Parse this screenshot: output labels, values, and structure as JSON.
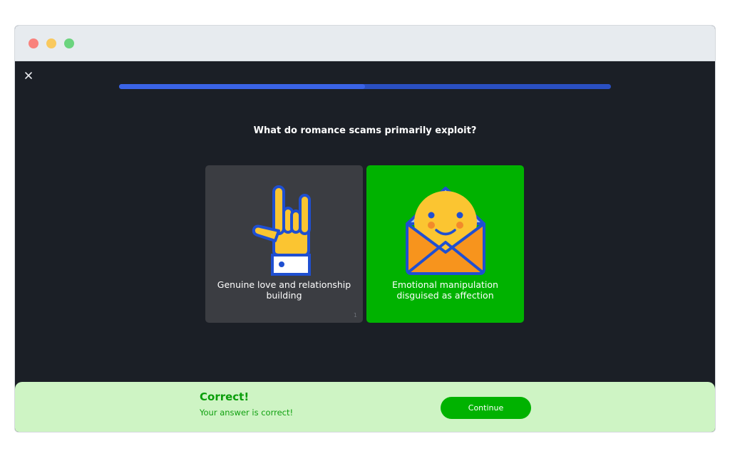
{
  "window": {
    "controls": [
      "close-dot",
      "minimize-dot",
      "zoom-dot"
    ]
  },
  "toolbar": {
    "close_icon": "×"
  },
  "progress": {
    "fraction": 0.5
  },
  "question": {
    "text": "What do romance scams primarily exploit?"
  },
  "options": [
    {
      "label": "Genuine love and relationship building",
      "key": "1",
      "icon": "rock-on-hand-icon",
      "state": "neutral"
    },
    {
      "label": "Emotional manipulation disguised as affection",
      "key": "2",
      "icon": "smiley-envelope-icon",
      "state": "correct"
    }
  ],
  "feedback": {
    "title": "Correct!",
    "subtitle": "Your answer is correct!",
    "continue_label": "Continue"
  },
  "colors": {
    "background": "#1b1f26",
    "progress": "#3a63e6",
    "correct": "#00b200",
    "feedback_bg": "#cef4c4"
  }
}
